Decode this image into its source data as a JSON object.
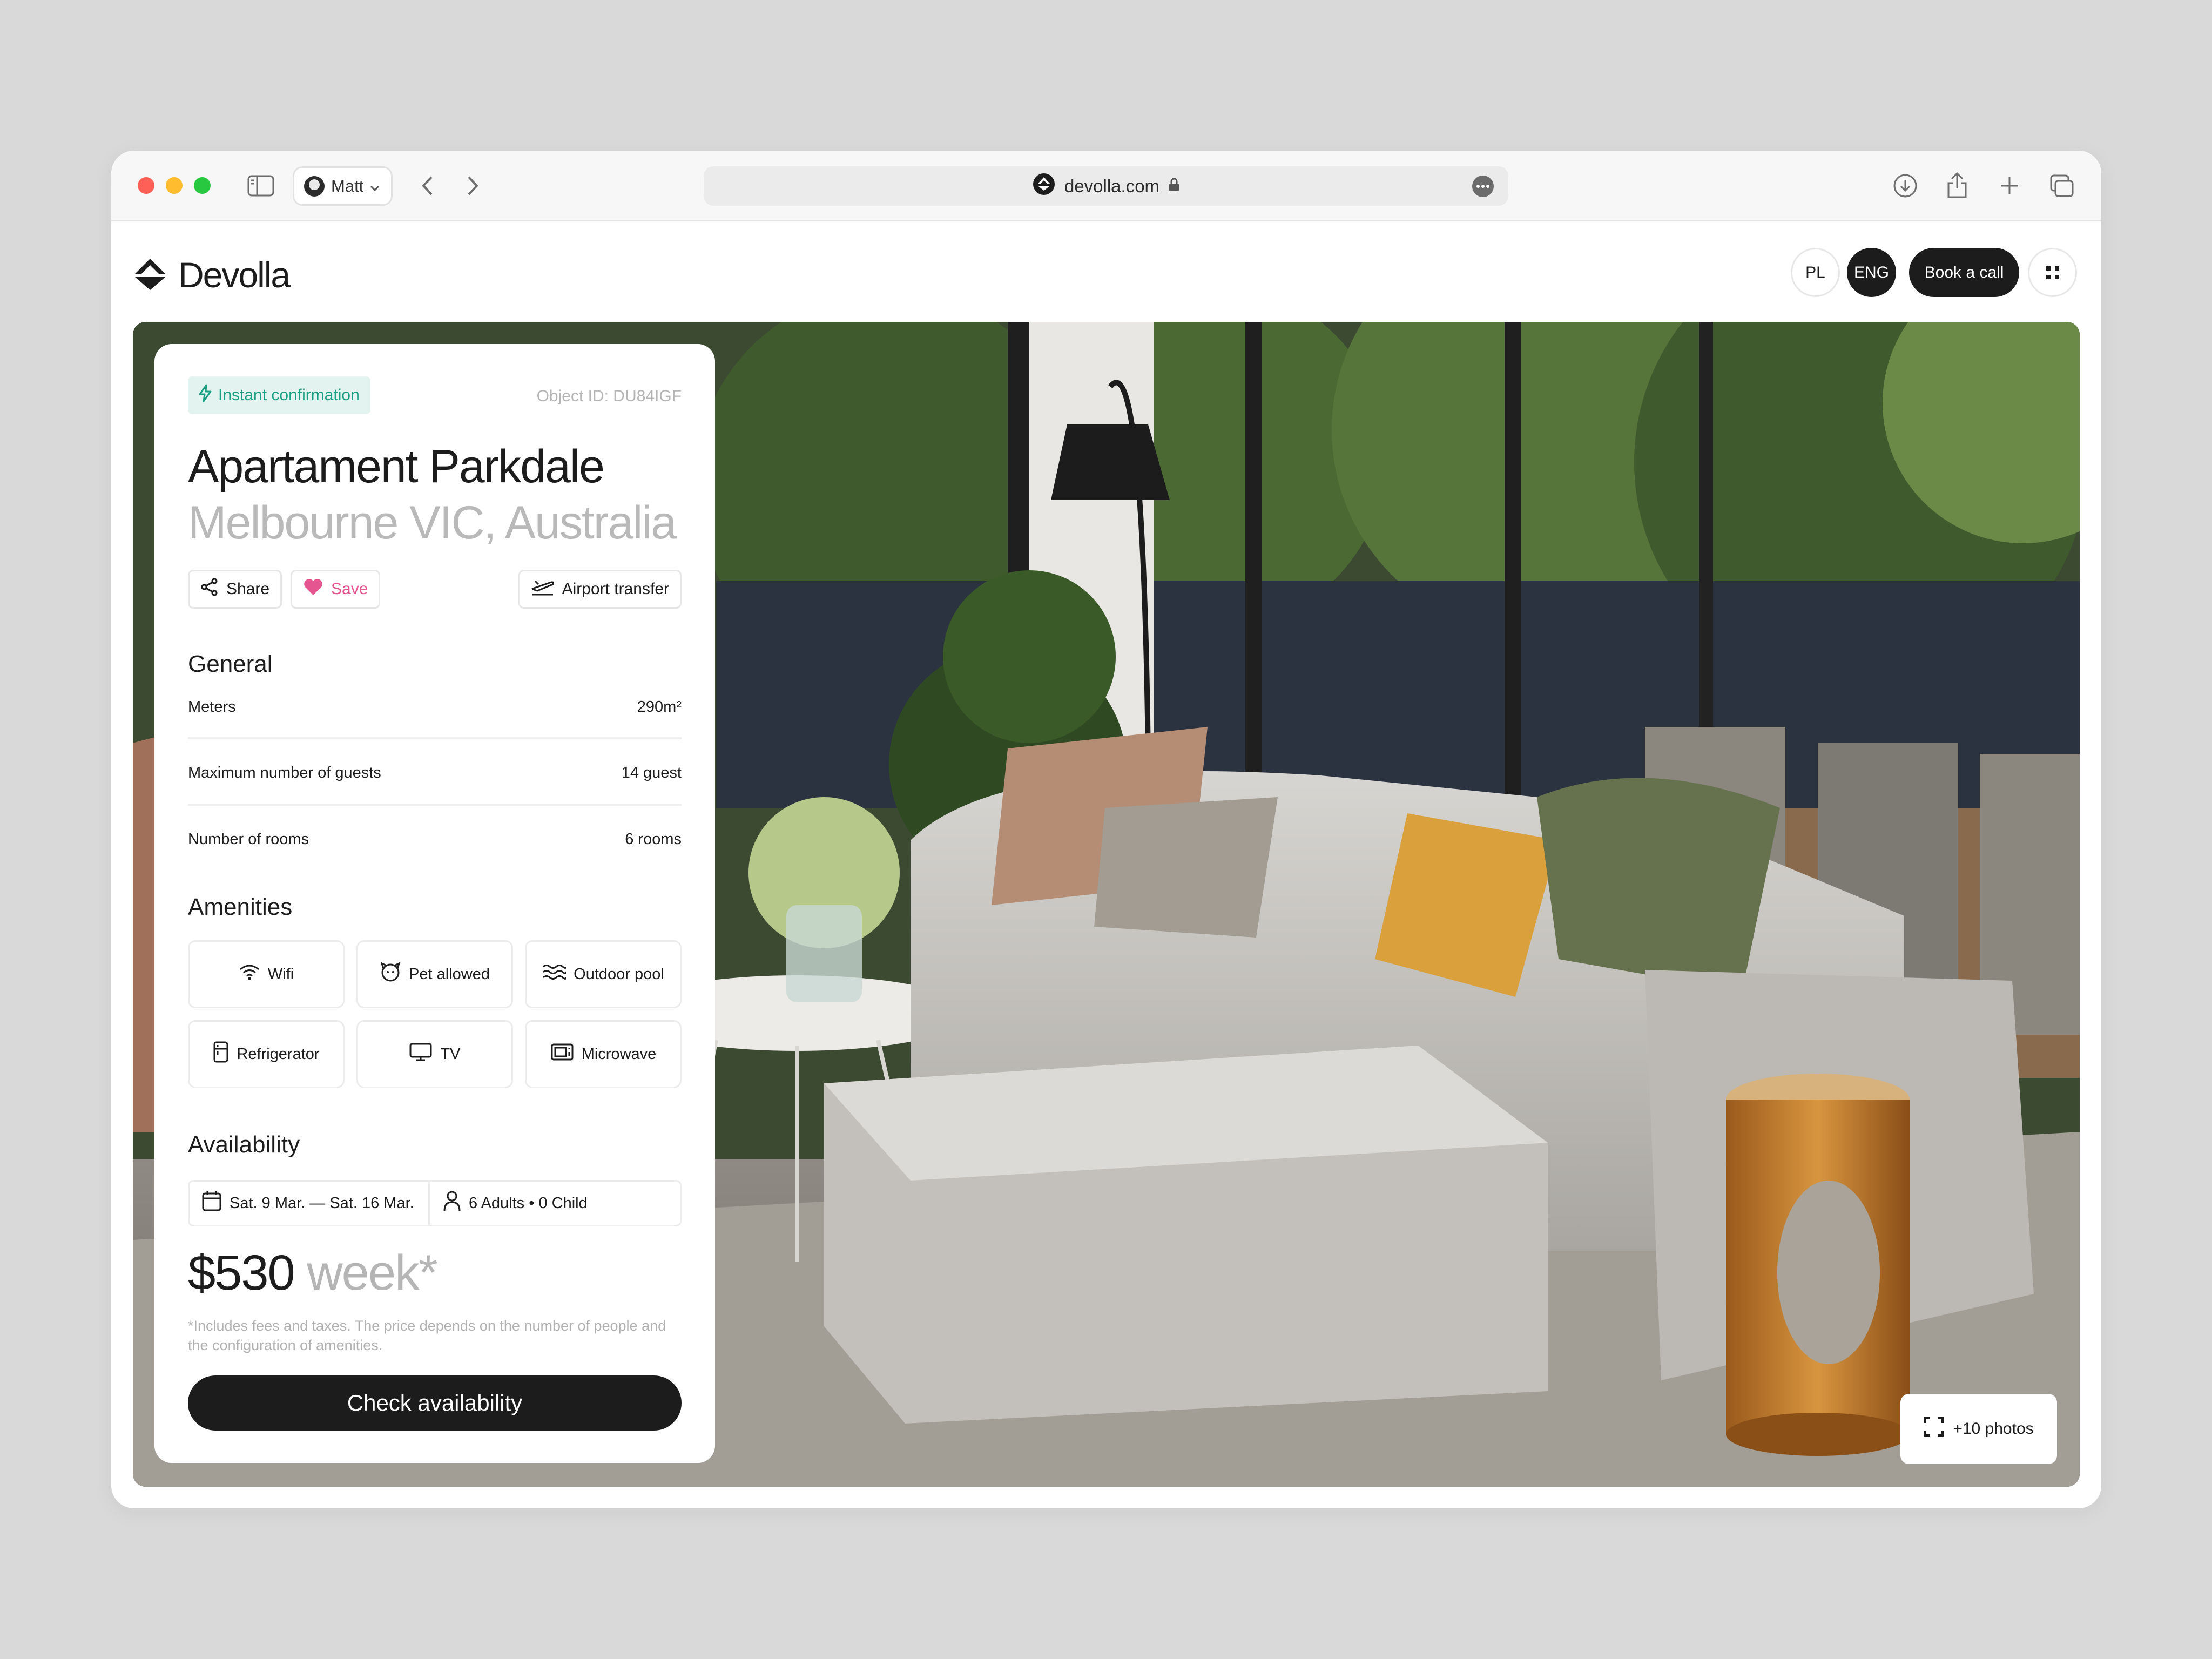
{
  "browser": {
    "profile_name": "Matt",
    "url": "devolla.com"
  },
  "site": {
    "brand": "Devolla",
    "lang_pl": "PL",
    "lang_eng": "ENG",
    "book_call": "Book a call"
  },
  "listing": {
    "badge": "Instant confirmation",
    "object_id": "Object ID: DU84IGF",
    "title": "Apartament Parkdale",
    "location": "Melbourne VIC, Australia",
    "share": "Share",
    "save": "Save",
    "airport_transfer": "Airport transfer"
  },
  "general": {
    "heading": "General",
    "rows": [
      {
        "label": "Meters",
        "value": "290m²"
      },
      {
        "label": "Maximum number of guests",
        "value": "14 guest"
      },
      {
        "label": "Number of rooms",
        "value": "6 rooms"
      }
    ]
  },
  "amenities": {
    "heading": "Amenities",
    "items": [
      {
        "label": "Wifi",
        "icon": "wifi-icon"
      },
      {
        "label": "Pet allowed",
        "icon": "pet-icon"
      },
      {
        "label": "Outdoor pool",
        "icon": "pool-icon"
      },
      {
        "label": "Refrigerator",
        "icon": "refrigerator-icon"
      },
      {
        "label": "TV",
        "icon": "tv-icon"
      },
      {
        "label": "Microwave",
        "icon": "microwave-icon"
      }
    ]
  },
  "availability": {
    "heading": "Availability",
    "dates": "Sat. 9 Mar. — Sat. 16 Mar.",
    "guests": "6 Adults • 0 Child"
  },
  "pricing": {
    "amount": "$530",
    "period": "week*",
    "note": "*Includes fees and taxes. The price depends on the number of people and the configuration of amenities.",
    "cta": "Check availability"
  },
  "gallery": {
    "more_photos": "+10 photos"
  },
  "colors": {
    "accent_green": "#19a082",
    "save_pink": "#e5558f",
    "dark": "#1c1c1c"
  }
}
